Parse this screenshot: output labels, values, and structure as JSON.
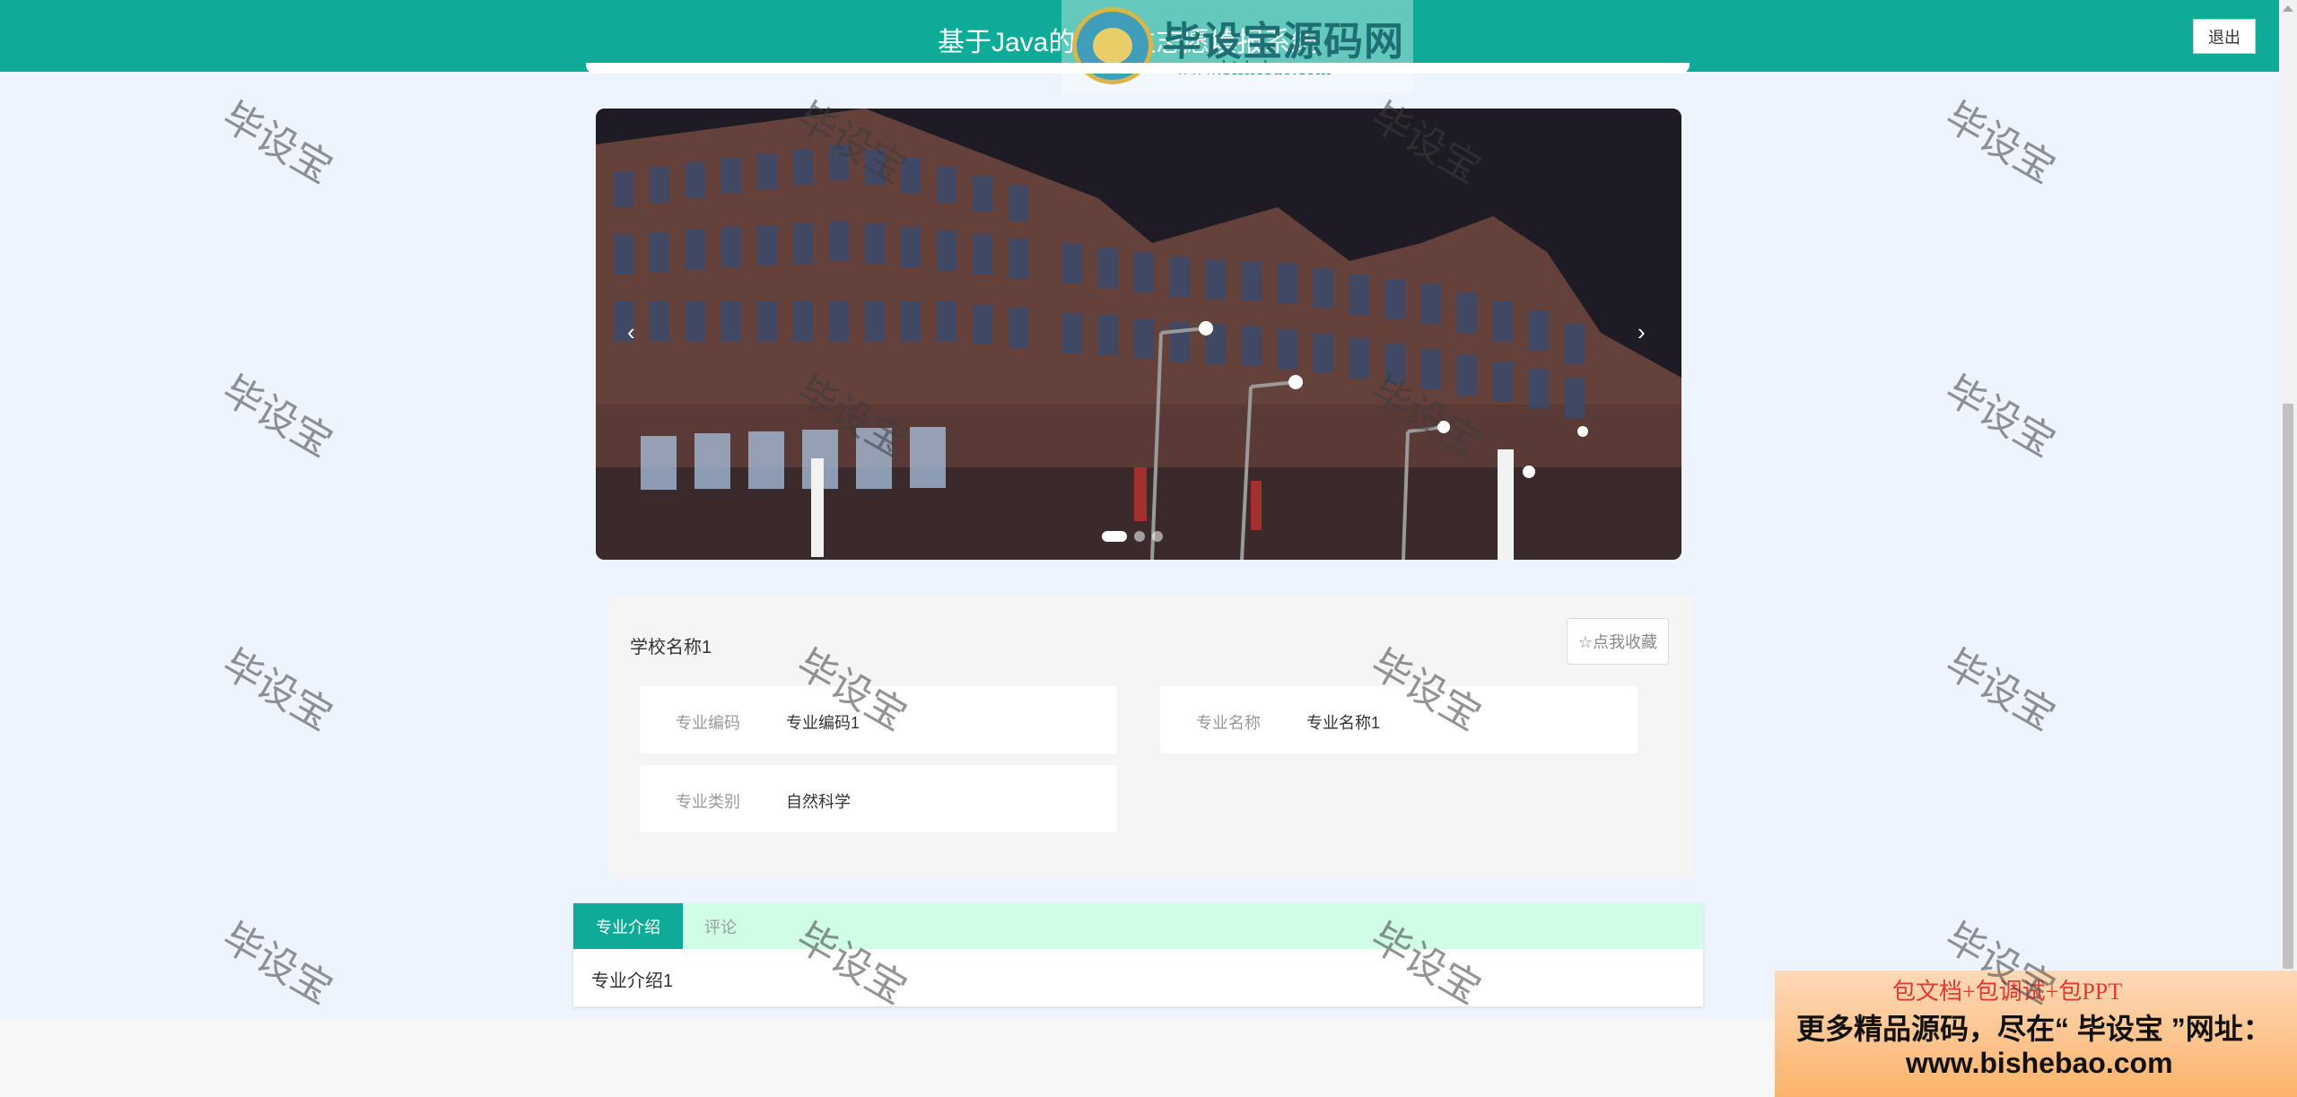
{
  "header": {
    "title": "基于Java的大学生志愿填报系统",
    "logo_text": "毕设宝源码网",
    "logo_url": "www.bishebao.com",
    "logout_label": "退出"
  },
  "carousel": {
    "prev_label": "‹",
    "next_label": "›",
    "slide_count": 3,
    "active_index": 0
  },
  "detail": {
    "school_name": "学校名称1",
    "favorite_label": "☆点我收藏",
    "fields": [
      {
        "label": "专业编码",
        "value": "专业编码1"
      },
      {
        "label": "专业名称",
        "value": "专业名称1"
      },
      {
        "label": "专业类别",
        "value": "自然科学"
      }
    ]
  },
  "tabs": {
    "items": [
      {
        "label": "专业介绍",
        "active": true
      },
      {
        "label": "评论",
        "active": false
      }
    ],
    "content": "专业介绍1"
  },
  "ad": {
    "line1": "包文档+包调试+包PPT",
    "line2": "更多精品源码，尽在“ 毕设宝 ”网址：",
    "line3": "www.bishebao.com"
  },
  "watermark_text": "毕设宝",
  "colors": {
    "accent": "#0eac98",
    "page_background": "#edf4fe",
    "tab_strip": "#d0fde6"
  }
}
